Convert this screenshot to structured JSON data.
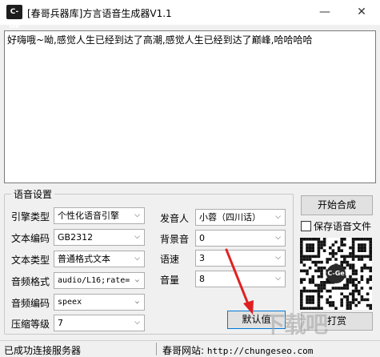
{
  "window": {
    "title": "[春哥兵器库]方言语音生成器V1.1",
    "icon_text": "C-Ge",
    "minimize_icon": "minimize-icon",
    "close_icon": "close-icon"
  },
  "editor": {
    "text": "好嗨哦~呦,感觉人生已经到达了高潮,感觉人生已经到达了巅峰,哈哈哈哈"
  },
  "settings": {
    "group_title": "语音设置",
    "engine_type": {
      "label": "引擎类型",
      "value": "个性化语音引擎"
    },
    "text_encoding": {
      "label": "文本编码",
      "value": "GB2312"
    },
    "text_type": {
      "label": "文本类型",
      "value": "普通格式文本"
    },
    "audio_format": {
      "label": "音频格式",
      "value": "audio/L16;rate="
    },
    "audio_encoding": {
      "label": "音频编码",
      "value": "speex"
    },
    "compression_level": {
      "label": "压缩等级",
      "value": "7"
    },
    "speaker": {
      "label": "发音人",
      "value": "小蓉（四川话）"
    },
    "background_sound": {
      "label": "背景音",
      "value": "0"
    },
    "speed": {
      "label": "语速",
      "value": "3"
    },
    "volume": {
      "label": "音量",
      "value": "8"
    },
    "default_button": "默认值"
  },
  "actions": {
    "start_button": "开始合成",
    "save_checkbox_label": "保存语音文件",
    "save_checked": false,
    "tip_button": "打赏",
    "qr_logo_text": "C-Ge"
  },
  "status": {
    "left": "已成功连接服务器",
    "site_label": "春哥网站:",
    "site_url": "http://chungeseo.com"
  },
  "colors": {
    "arrow": "#e02020",
    "focus_border": "#0078d7"
  }
}
